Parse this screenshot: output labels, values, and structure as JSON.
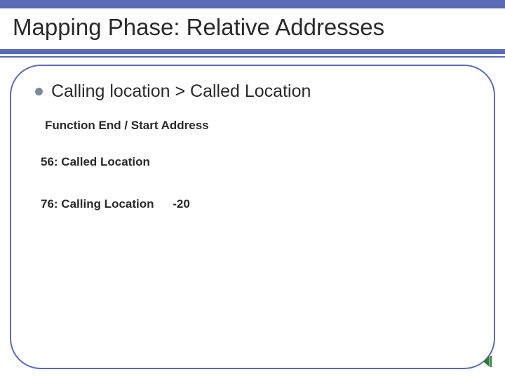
{
  "title": "Mapping Phase: Relative Addresses",
  "bullet": "Calling location > Called Location",
  "line_function": "Function End / Start Address",
  "line_called": "56: Called Location",
  "line_calling": "76: Calling Location",
  "offset": "-20",
  "nav_icon_name": "prev-slide-icon"
}
